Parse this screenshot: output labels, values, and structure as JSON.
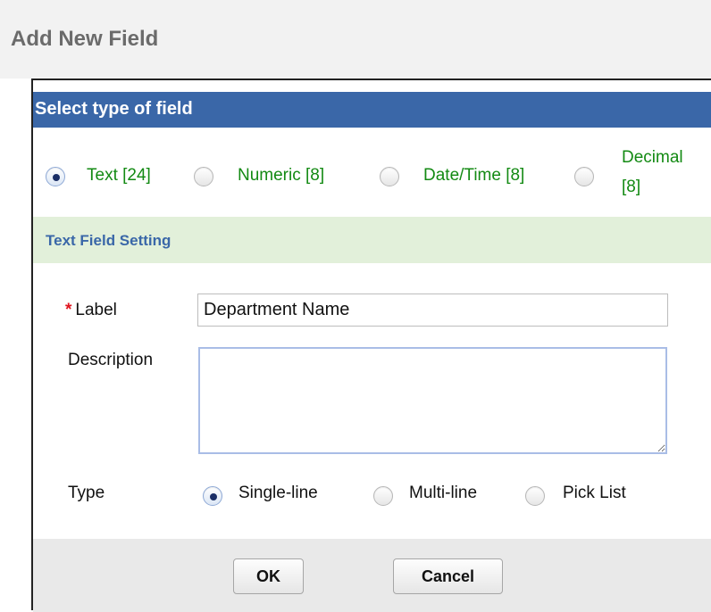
{
  "page": {
    "title": "Add New Field"
  },
  "dialog": {
    "title": "Select type of field",
    "field_types": [
      {
        "label": "Text [24]",
        "selected": true
      },
      {
        "label": "Numeric [8]",
        "selected": false
      },
      {
        "label": "Date/Time [8]",
        "selected": false
      },
      {
        "label_line1": "Decimal",
        "label_line2": "[8]",
        "selected": false
      }
    ],
    "section_title": "Text Field Setting",
    "form": {
      "label_required_mark": "*",
      "label_caption": "Label",
      "label_value": "Department Name",
      "description_caption": "Description",
      "description_value": "",
      "type_caption": "Type",
      "type_options": [
        {
          "label": "Single-line",
          "selected": true
        },
        {
          "label": "Multi-line",
          "selected": false
        },
        {
          "label": "Pick List",
          "selected": false
        }
      ]
    },
    "buttons": {
      "ok": "OK",
      "cancel": "Cancel"
    }
  },
  "colors": {
    "titlebar": "#3a67a8",
    "field_type_text": "#138a13",
    "section_bar": "#e2f0da",
    "required": "#e0141e"
  }
}
